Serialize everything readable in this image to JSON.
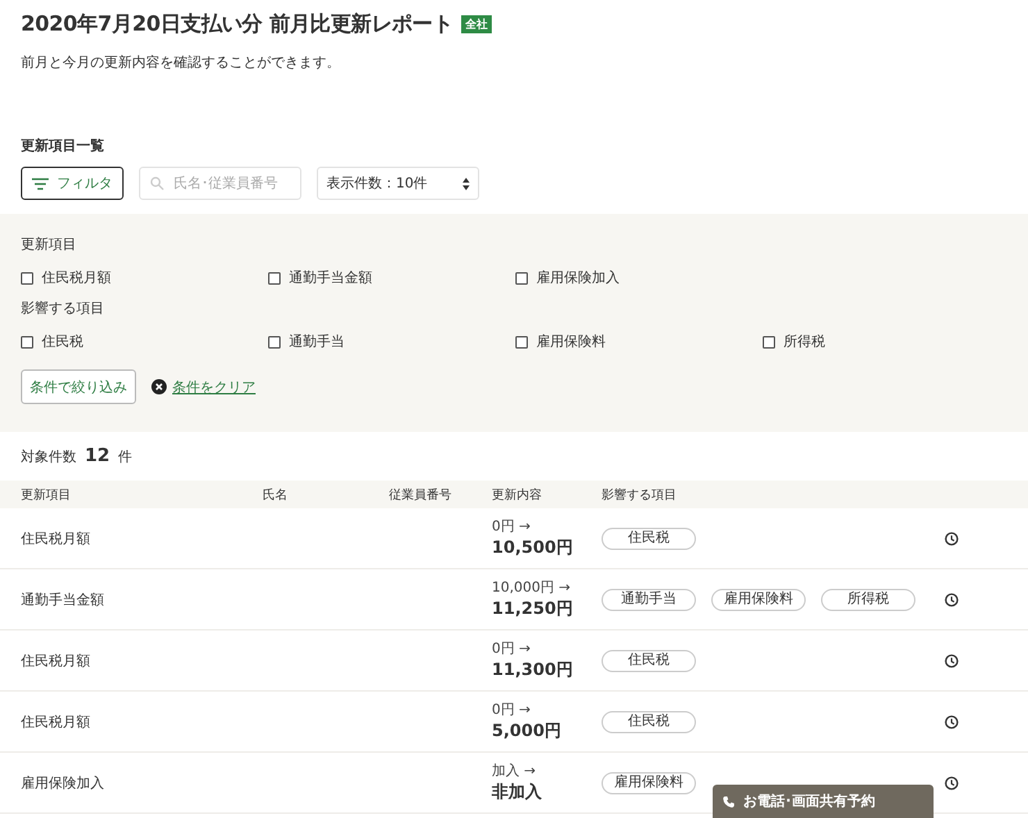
{
  "page": {
    "title": "2020年7月20日支払い分 前月比更新レポート",
    "badge": "全社",
    "description": "前月と今月の更新内容を確認することができます。"
  },
  "list_heading": "更新項目一覧",
  "toolbar": {
    "filter_button": "フィルタ",
    "search": {
      "placeholder": "氏名･従業員番号"
    },
    "page_size": {
      "value": "表示件数：10件"
    }
  },
  "filter_panel": {
    "groups": [
      {
        "label": "更新項目",
        "options": [
          {
            "label": "住民税月額",
            "checked": false
          },
          {
            "label": "通勤手当金額",
            "checked": false
          },
          {
            "label": "雇用保険加入",
            "checked": false
          }
        ]
      },
      {
        "label": "影響する項目",
        "options": [
          {
            "label": "住民税",
            "checked": false
          },
          {
            "label": "通勤手当",
            "checked": false
          },
          {
            "label": "雇用保険料",
            "checked": false
          },
          {
            "label": "所得税",
            "checked": false
          }
        ]
      }
    ],
    "apply_button": "条件で絞り込み",
    "clear_link": "条件をクリア"
  },
  "result_count": {
    "label": "対象件数",
    "count": "12",
    "unit": "件"
  },
  "table": {
    "columns": [
      "更新項目",
      "氏名",
      "従業員番号",
      "更新内容",
      "影響する項目"
    ],
    "rows": [
      {
        "item": "住民税月額",
        "before": "0円 →",
        "after": "10,500円",
        "tags": [
          "住民税"
        ]
      },
      {
        "item": "通勤手当金額",
        "before": "10,000円 →",
        "after": "11,250円",
        "tags": [
          "通勤手当",
          "雇用保険料",
          "所得税"
        ]
      },
      {
        "item": "住民税月額",
        "before": "0円 →",
        "after": "11,300円",
        "tags": [
          "住民税"
        ]
      },
      {
        "item": "住民税月額",
        "before": "0円 →",
        "after": "5,000円",
        "tags": [
          "住民税"
        ]
      },
      {
        "item": "雇用保険加入",
        "before": "加入 →",
        "after": "非加入",
        "tags": [
          "雇用保険料"
        ]
      }
    ]
  },
  "contact_banner": {
    "label": "お電話･画面共有予約"
  }
}
